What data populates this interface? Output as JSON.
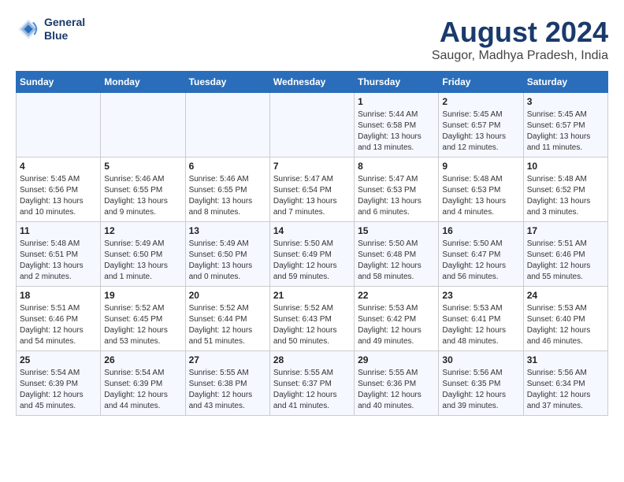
{
  "logo": {
    "line1": "General",
    "line2": "Blue"
  },
  "title": "August 2024",
  "subtitle": "Saugor, Madhya Pradesh, India",
  "days_of_week": [
    "Sunday",
    "Monday",
    "Tuesday",
    "Wednesday",
    "Thursday",
    "Friday",
    "Saturday"
  ],
  "weeks": [
    [
      {
        "num": "",
        "info": ""
      },
      {
        "num": "",
        "info": ""
      },
      {
        "num": "",
        "info": ""
      },
      {
        "num": "",
        "info": ""
      },
      {
        "num": "1",
        "info": "Sunrise: 5:44 AM\nSunset: 6:58 PM\nDaylight: 13 hours\nand 13 minutes."
      },
      {
        "num": "2",
        "info": "Sunrise: 5:45 AM\nSunset: 6:57 PM\nDaylight: 13 hours\nand 12 minutes."
      },
      {
        "num": "3",
        "info": "Sunrise: 5:45 AM\nSunset: 6:57 PM\nDaylight: 13 hours\nand 11 minutes."
      }
    ],
    [
      {
        "num": "4",
        "info": "Sunrise: 5:45 AM\nSunset: 6:56 PM\nDaylight: 13 hours\nand 10 minutes."
      },
      {
        "num": "5",
        "info": "Sunrise: 5:46 AM\nSunset: 6:55 PM\nDaylight: 13 hours\nand 9 minutes."
      },
      {
        "num": "6",
        "info": "Sunrise: 5:46 AM\nSunset: 6:55 PM\nDaylight: 13 hours\nand 8 minutes."
      },
      {
        "num": "7",
        "info": "Sunrise: 5:47 AM\nSunset: 6:54 PM\nDaylight: 13 hours\nand 7 minutes."
      },
      {
        "num": "8",
        "info": "Sunrise: 5:47 AM\nSunset: 6:53 PM\nDaylight: 13 hours\nand 6 minutes."
      },
      {
        "num": "9",
        "info": "Sunrise: 5:48 AM\nSunset: 6:53 PM\nDaylight: 13 hours\nand 4 minutes."
      },
      {
        "num": "10",
        "info": "Sunrise: 5:48 AM\nSunset: 6:52 PM\nDaylight: 13 hours\nand 3 minutes."
      }
    ],
    [
      {
        "num": "11",
        "info": "Sunrise: 5:48 AM\nSunset: 6:51 PM\nDaylight: 13 hours\nand 2 minutes."
      },
      {
        "num": "12",
        "info": "Sunrise: 5:49 AM\nSunset: 6:50 PM\nDaylight: 13 hours\nand 1 minute."
      },
      {
        "num": "13",
        "info": "Sunrise: 5:49 AM\nSunset: 6:50 PM\nDaylight: 13 hours\nand 0 minutes."
      },
      {
        "num": "14",
        "info": "Sunrise: 5:50 AM\nSunset: 6:49 PM\nDaylight: 12 hours\nand 59 minutes."
      },
      {
        "num": "15",
        "info": "Sunrise: 5:50 AM\nSunset: 6:48 PM\nDaylight: 12 hours\nand 58 minutes."
      },
      {
        "num": "16",
        "info": "Sunrise: 5:50 AM\nSunset: 6:47 PM\nDaylight: 12 hours\nand 56 minutes."
      },
      {
        "num": "17",
        "info": "Sunrise: 5:51 AM\nSunset: 6:46 PM\nDaylight: 12 hours\nand 55 minutes."
      }
    ],
    [
      {
        "num": "18",
        "info": "Sunrise: 5:51 AM\nSunset: 6:46 PM\nDaylight: 12 hours\nand 54 minutes."
      },
      {
        "num": "19",
        "info": "Sunrise: 5:52 AM\nSunset: 6:45 PM\nDaylight: 12 hours\nand 53 minutes."
      },
      {
        "num": "20",
        "info": "Sunrise: 5:52 AM\nSunset: 6:44 PM\nDaylight: 12 hours\nand 51 minutes."
      },
      {
        "num": "21",
        "info": "Sunrise: 5:52 AM\nSunset: 6:43 PM\nDaylight: 12 hours\nand 50 minutes."
      },
      {
        "num": "22",
        "info": "Sunrise: 5:53 AM\nSunset: 6:42 PM\nDaylight: 12 hours\nand 49 minutes."
      },
      {
        "num": "23",
        "info": "Sunrise: 5:53 AM\nSunset: 6:41 PM\nDaylight: 12 hours\nand 48 minutes."
      },
      {
        "num": "24",
        "info": "Sunrise: 5:53 AM\nSunset: 6:40 PM\nDaylight: 12 hours\nand 46 minutes."
      }
    ],
    [
      {
        "num": "25",
        "info": "Sunrise: 5:54 AM\nSunset: 6:39 PM\nDaylight: 12 hours\nand 45 minutes."
      },
      {
        "num": "26",
        "info": "Sunrise: 5:54 AM\nSunset: 6:39 PM\nDaylight: 12 hours\nand 44 minutes."
      },
      {
        "num": "27",
        "info": "Sunrise: 5:55 AM\nSunset: 6:38 PM\nDaylight: 12 hours\nand 43 minutes."
      },
      {
        "num": "28",
        "info": "Sunrise: 5:55 AM\nSunset: 6:37 PM\nDaylight: 12 hours\nand 41 minutes."
      },
      {
        "num": "29",
        "info": "Sunrise: 5:55 AM\nSunset: 6:36 PM\nDaylight: 12 hours\nand 40 minutes."
      },
      {
        "num": "30",
        "info": "Sunrise: 5:56 AM\nSunset: 6:35 PM\nDaylight: 12 hours\nand 39 minutes."
      },
      {
        "num": "31",
        "info": "Sunrise: 5:56 AM\nSunset: 6:34 PM\nDaylight: 12 hours\nand 37 minutes."
      }
    ]
  ]
}
